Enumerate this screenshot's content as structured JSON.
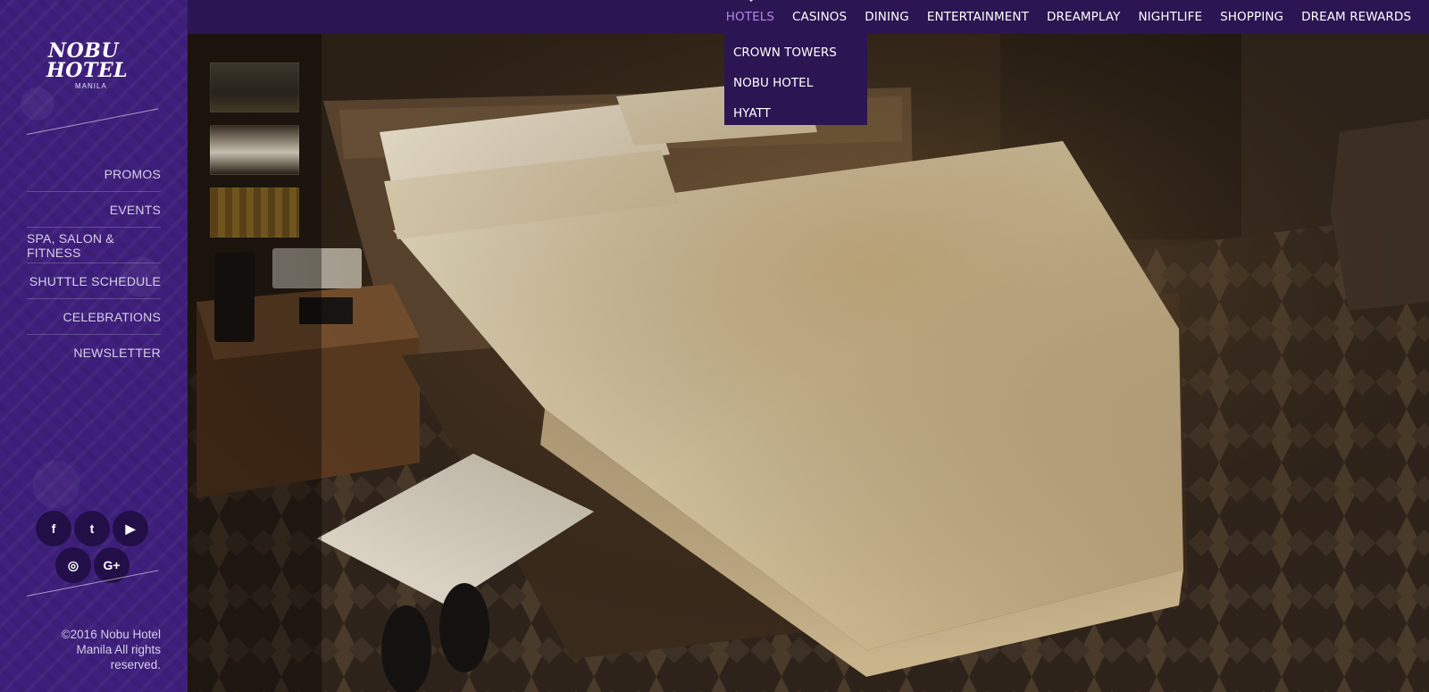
{
  "brand": {
    "line1": "NOBU",
    "line2": "HOTEL",
    "line3": "MANILA"
  },
  "sidebar": {
    "items": [
      {
        "label": "PROMOS"
      },
      {
        "label": "EVENTS"
      },
      {
        "label": "SPA, SALON & FITNESS"
      },
      {
        "label": "SHUTTLE SCHEDULE"
      },
      {
        "label": "CELEBRATIONS"
      },
      {
        "label": "NEWSLETTER"
      }
    ],
    "social": [
      {
        "icon": "facebook-icon",
        "glyph": "f"
      },
      {
        "icon": "twitter-icon",
        "glyph": "t"
      },
      {
        "icon": "youtube-icon",
        "glyph": "▶"
      },
      {
        "icon": "instagram-icon",
        "glyph": "◎"
      },
      {
        "icon": "google-plus-icon",
        "glyph": "G+"
      }
    ],
    "copyright": "©2016 Nobu Hotel Manila All rights reserved."
  },
  "topnav": {
    "items": [
      {
        "label": "HOTELS"
      },
      {
        "label": "CASINOS"
      },
      {
        "label": "DINING"
      },
      {
        "label": "ENTERTAINMENT"
      },
      {
        "label": "DREAMPLAY"
      },
      {
        "label": "NIGHTLIFE"
      },
      {
        "label": "SHOPPING"
      },
      {
        "label": "DREAM REWARDS"
      }
    ],
    "dropdown": [
      {
        "label": "CROWN TOWERS"
      },
      {
        "label": "NOBU HOTEL"
      },
      {
        "label": "HYATT"
      }
    ]
  },
  "colors": {
    "sidebar_bg": "#3e1f7c",
    "nav_bg": "#2b1552",
    "active_nav": "#b388e8"
  }
}
